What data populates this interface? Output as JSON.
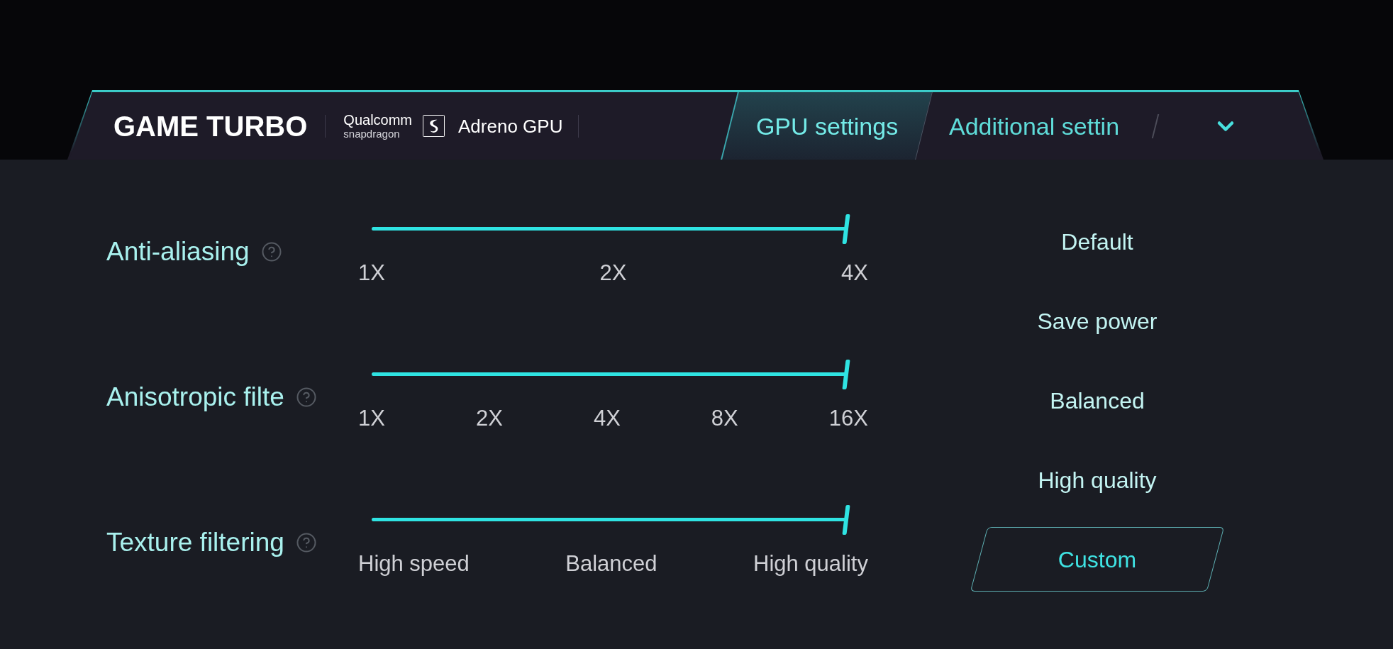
{
  "header": {
    "title": "GAME TURBO",
    "chip_logo": {
      "wordmark": "Qualcomm",
      "subtitle": "snapdragon"
    },
    "gpu": "Adreno GPU",
    "tabs": [
      {
        "label": "GPU settings",
        "selected": true
      },
      {
        "label": "Additional settin",
        "selected": false
      }
    ]
  },
  "settings": [
    {
      "label": "Anti-aliasing",
      "level": 1,
      "stops": [
        "1X",
        "2X",
        "4X"
      ]
    },
    {
      "label": "Anisotropic filte",
      "level": 1,
      "stops": [
        "1X",
        "2X",
        "4X",
        "8X",
        "16X"
      ]
    },
    {
      "label": "Texture filtering",
      "level": 1,
      "stops": [
        "High speed",
        "Balanced",
        "High quality"
      ]
    }
  ],
  "presets": [
    {
      "label": "Default",
      "selected": false
    },
    {
      "label": "Save power",
      "selected": false
    },
    {
      "label": "Balanced",
      "selected": false
    },
    {
      "label": "High quality",
      "selected": false
    },
    {
      "label": "Custom",
      "selected": true
    }
  ]
}
